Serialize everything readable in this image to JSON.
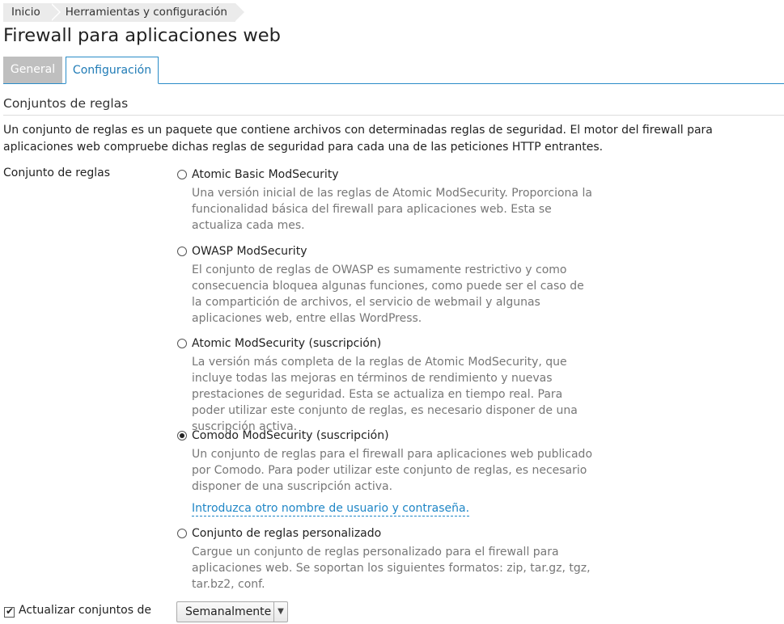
{
  "breadcrumb": {
    "items": [
      "Inicio",
      "Herramientas y configuración"
    ]
  },
  "page_title": "Firewall para aplicaciones web",
  "tabs": [
    {
      "label": "General",
      "active": false
    },
    {
      "label": "Configuración",
      "active": true
    }
  ],
  "section": {
    "title": "Conjuntos de reglas",
    "intro": "Un conjunto de reglas es un paquete que contiene archivos con determinadas reglas de seguridad. El motor del firewall para aplicaciones web compruebe dichas reglas de seguridad para cada una de las peticiones HTTP entrantes."
  },
  "ruleset": {
    "label": "Conjunto de reglas",
    "options": [
      {
        "title": "Atomic Basic ModSecurity",
        "checked": false,
        "description": "Una versión inicial de las reglas de Atomic ModSecurity. Proporciona la funcionalidad básica del firewall para aplicaciones web. Esta se actualiza cada mes."
      },
      {
        "title": "OWASP ModSecurity",
        "checked": false,
        "description": "El conjunto de reglas de OWASP es sumamente restrictivo y como consecuencia bloquea algunas funciones, como puede ser el caso de la compartición de archivos, el servicio de webmail y algunas aplicaciones web, entre ellas WordPress."
      },
      {
        "title": "Atomic ModSecurity (suscripción)",
        "checked": false,
        "description": "La versión más completa de la reglas de Atomic ModSecurity, que incluye todas las mejoras en términos de rendimiento y nuevas prestaciones de seguridad. Esta se actualiza en tiempo real. Para poder utilizar este conjunto de reglas, es necesario disponer de una suscripción activa."
      },
      {
        "title": "Comodo ModSecurity (suscripción)",
        "checked": true,
        "description": "Un conjunto de reglas para el firewall para aplicaciones web publicado por Comodo. Para poder utilizar este conjunto de reglas, es necesario disponer de una suscripción activa.",
        "link": "Introduzca otro nombre de usuario y contraseña."
      },
      {
        "title": "Conjunto de reglas personalizado",
        "checked": false,
        "description": "Cargue un conjunto de reglas personalizado para el firewall para aplicaciones web. Se soportan los siguientes formatos: zip, tar.gz, tgz, tar.bz2, conf."
      }
    ]
  },
  "update": {
    "checkbox_label": "Actualizar conjuntos de",
    "checked": true,
    "frequency": "Semanalmente"
  }
}
